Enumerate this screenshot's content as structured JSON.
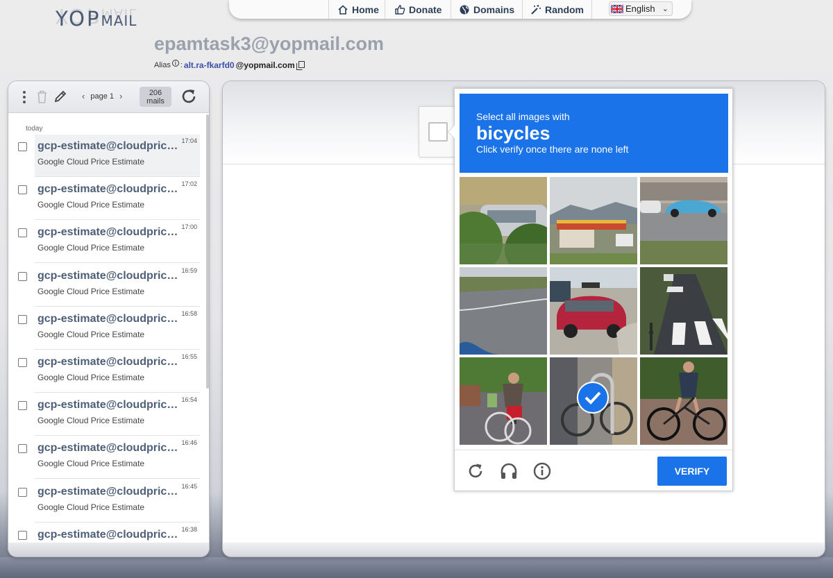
{
  "logo": {
    "text": "YOPMAIL",
    "part1": "YOP",
    "part2": "MAIL"
  },
  "nav": {
    "home": "Home",
    "donate": "Donate",
    "domains": "Domains",
    "random": "Random",
    "language": "English"
  },
  "header": {
    "email": "epamtask3@yopmail.com",
    "alias_label": "Alias",
    "alias_sep": ":",
    "alias_prefix": "alt.ra-fkarfd0",
    "alias_domain": "@yopmail.com"
  },
  "inbox": {
    "page_label": "page 1",
    "mail_count": "206",
    "mail_count_unit": "mails",
    "day_label": "today",
    "items": [
      {
        "from": "gcp-estimate@cloudpricingcalculator.appspotmail.com",
        "subject": "Google Cloud Price Estimate",
        "time": "17:04"
      },
      {
        "from": "gcp-estimate@cloudpricingcalculator.appspotmail.com",
        "subject": "Google Cloud Price Estimate",
        "time": "17:02"
      },
      {
        "from": "gcp-estimate@cloudpricingcalculator.appspotmail.com",
        "subject": "Google Cloud Price Estimate",
        "time": "17:00"
      },
      {
        "from": "gcp-estimate@cloudpricingcalculator.appspotmail.com",
        "subject": "Google Cloud Price Estimate",
        "time": "16:59"
      },
      {
        "from": "gcp-estimate@cloudpricingcalculator.appspotmail.com",
        "subject": "Google Cloud Price Estimate",
        "time": "16:58"
      },
      {
        "from": "gcp-estimate@cloudpricingcalculator.appspotmail.com",
        "subject": "Google Cloud Price Estimate",
        "time": "16:55"
      },
      {
        "from": "gcp-estimate@cloudpricingcalculator.appspotmail.com",
        "subject": "Google Cloud Price Estimate",
        "time": "16:54"
      },
      {
        "from": "gcp-estimate@cloudpricingcalculator.appspotmail.com",
        "subject": "Google Cloud Price Estimate",
        "time": "16:46"
      },
      {
        "from": "gcp-estimate@cloudpricingcalculator.appspotmail.com",
        "subject": "Google Cloud Price Estimate",
        "time": "16:45"
      },
      {
        "from": "gcp-estimate@cloudpricingcalculator.appspotmail.com",
        "subject": "",
        "time": "16:38"
      }
    ]
  },
  "captcha": {
    "instruction": "Select all images with",
    "target": "bicycles",
    "sub_instruction": "Click verify once there are none left",
    "verify_label": "VERIFY",
    "tiles": [
      {
        "scene": "hedge-and-car",
        "selected": false
      },
      {
        "scene": "gas-station",
        "selected": false
      },
      {
        "scene": "street-cars",
        "selected": false
      },
      {
        "scene": "road-curve",
        "selected": false
      },
      {
        "scene": "red-car-parking",
        "selected": false
      },
      {
        "scene": "crosswalk",
        "selected": false
      },
      {
        "scene": "cyclist-with-bags",
        "selected": false
      },
      {
        "scene": "parked-bicycle",
        "selected": true
      },
      {
        "scene": "cyclist-on-road",
        "selected": false
      }
    ],
    "accent_color": "#1a73e8"
  },
  "colors": {
    "brand": "#4d5e77",
    "link": "#3a4fa8"
  }
}
